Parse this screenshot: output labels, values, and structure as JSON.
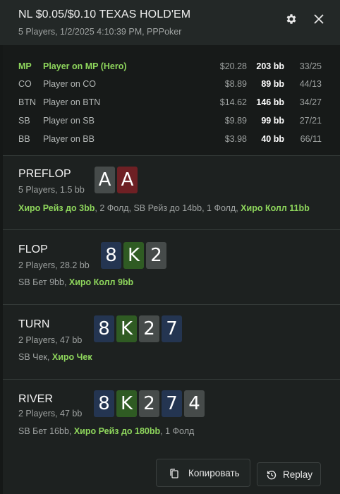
{
  "header": {
    "title": "NL $0.05/$0.10 TEXAS HOLD'EM",
    "subtitle": "5 Players, 1/2/2025 4:10:39 PM, PPPoker"
  },
  "players": [
    {
      "pos": "MP",
      "name": "Player on MP (Hero)",
      "money": "$20.28",
      "bb": "203 bb",
      "stat": "33/25"
    },
    {
      "pos": "CO",
      "name": "Player on CO",
      "money": "$8.89",
      "bb": "89 bb",
      "stat": "44/13"
    },
    {
      "pos": "BTN",
      "name": "Player on BTN",
      "money": "$14.62",
      "bb": "146 bb",
      "stat": "34/27"
    },
    {
      "pos": "SB",
      "name": "Player on SB",
      "money": "$9.89",
      "bb": "99 bb",
      "stat": "27/21"
    },
    {
      "pos": "BB",
      "name": "Player on BB",
      "money": "$3.98",
      "bb": "40 bb",
      "stat": "66/11"
    }
  ],
  "streets": {
    "preflop": {
      "name": "PREFLOP",
      "sub": "5 Players, 1.5 bb",
      "cards": [
        "A",
        "A"
      ],
      "actions": [
        "Хиро Рейз до 3bb",
        ", 2 Фолд, SB Рейз до 14bb, 1 Фолд, ",
        "Хиро Колл 11bb"
      ]
    },
    "flop": {
      "name": "FLOP",
      "sub": "2 Players, 28.2 bb",
      "cards": [
        "8",
        "K",
        "2"
      ],
      "actions": [
        "SB Бет 9bb, ",
        "Хиро Колл 9bb"
      ]
    },
    "turn": {
      "name": "TURN",
      "sub": "2 Players, 47 bb",
      "cards": [
        "8",
        "K",
        "2",
        "7"
      ],
      "actions": [
        "SB Чек, ",
        "Хиро Чек"
      ]
    },
    "river": {
      "name": "RIVER",
      "sub": "2 Players, 47 bb",
      "cards": [
        "8",
        "K",
        "2",
        "7",
        "4"
      ],
      "actions": [
        "SB Бет 16bb, ",
        "Хиро Рейз до 180bb",
        ", 1 Фолд"
      ]
    }
  },
  "buttons": {
    "copy": "Копировать",
    "replay": "Replay"
  },
  "icons": {
    "settings": "gear-icon",
    "close": "close-icon",
    "copy": "copy-icon",
    "replay": "replay-icon"
  },
  "colors": {
    "hero_green": "#8ed65c",
    "card_red": "#6e2024",
    "card_blue": "#243551",
    "card_green": "#2f5b23",
    "card_gray": "#464b4a"
  }
}
